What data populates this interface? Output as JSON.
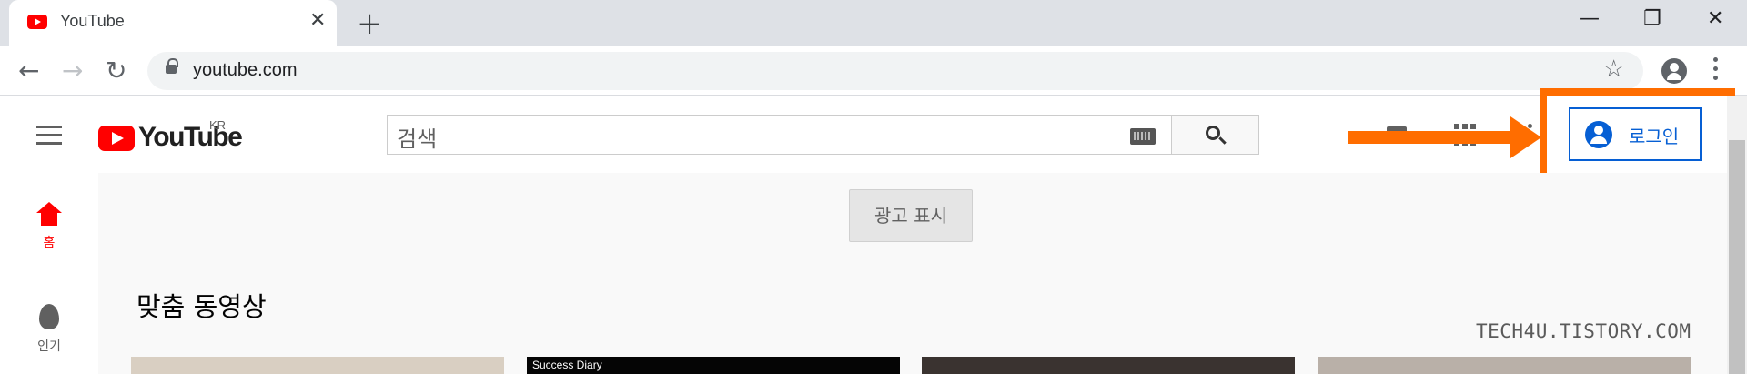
{
  "browser": {
    "tab": {
      "title": "YouTube",
      "close_glyph": "✕"
    },
    "new_tab_glyph": "+",
    "window_controls": {
      "minimize": "—",
      "restore": "❐",
      "close": "✕"
    },
    "nav": {
      "back": "←",
      "forward": "→",
      "reload": "↻"
    },
    "address": {
      "url": "youtube.com",
      "bookmark_glyph": "☆"
    }
  },
  "youtube": {
    "logo_text": "YouTube",
    "region": "KR",
    "search": {
      "placeholder": "검색"
    },
    "signin_label": "로그인",
    "sidebar": [
      {
        "label": "홈",
        "icon": "home-icon",
        "color": "#ff0000"
      },
      {
        "label": "인기",
        "icon": "fire-icon",
        "color": "#606060"
      }
    ],
    "ad_button": "광고 표시",
    "section_title": "맞춤 동영상",
    "thumbnails": [
      {
        "label": "",
        "color": "#d9cfc2"
      },
      {
        "label": "Success Diary",
        "color": "#050505"
      },
      {
        "label": "",
        "color": "#3a3330"
      },
      {
        "label": "",
        "color": "#b9b0a8"
      }
    ]
  },
  "annotation": {
    "color": "#ff6d00"
  },
  "watermark": "TECH4U.TISTORY.COM"
}
